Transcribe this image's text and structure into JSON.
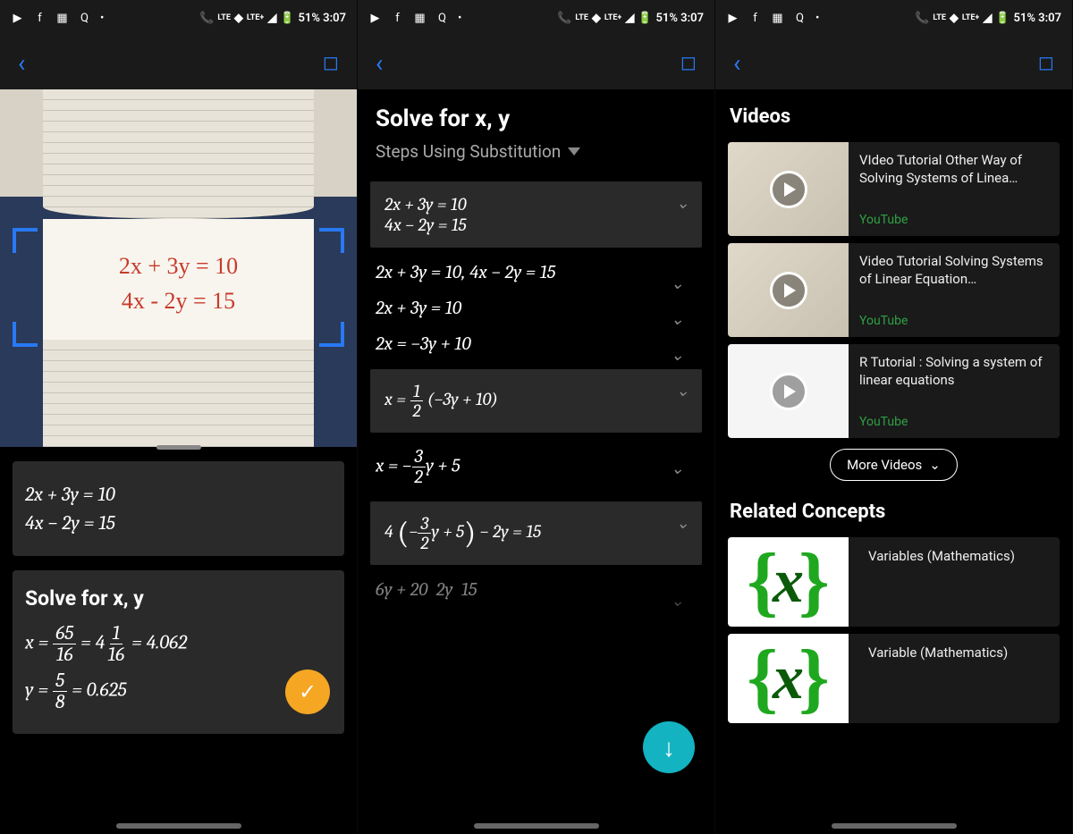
{
  "status": {
    "battery_time": "51% 3:07",
    "lte1": "LTE",
    "lte2": "LTE+"
  },
  "panel1": {
    "handwriting_line1": "2x + 3y = 10",
    "handwriting_line2": "4x - 2y = 15",
    "parsed_eq1": "2x + 3y = 10",
    "parsed_eq2": "4x − 2y = 15",
    "solve_title": "Solve for x, y",
    "sol_x": "x = 65/16 = 4 1/16 = 4.062",
    "sol_y": "y = 5/8 = 0.625"
  },
  "panel2": {
    "title": "Solve for x, y",
    "subtitle": "Steps Using Substitution",
    "step1a": "2x + 3y = 10",
    "step1b": "4x − 2y = 15",
    "step2": "2x + 3y = 10, 4x − 2y = 15",
    "step3": "2x + 3y = 10",
    "step4": "2x = −3y + 10",
    "step5": "x = 1/2 (−3y + 10)",
    "step6": "x = −3/2 y + 5",
    "step7": "4(−3/2 y + 5) − 2y = 15",
    "step8": "6y + 20 − 2y = 15"
  },
  "panel3": {
    "videos_title": "Videos",
    "v1_title": "VIdeo Tutorial Other Way of Solving Systems of Linea…",
    "v2_title": "Video Tutorial Solving Systems of Linear Equation…",
    "v3_title": "R Tutorial : Solving a system of linear equations",
    "source": "YouTube",
    "more": "More Videos",
    "concepts_title": "Related Concepts",
    "c1": "Variables (Mathematics)",
    "c2": "Variable (Mathematics)"
  }
}
